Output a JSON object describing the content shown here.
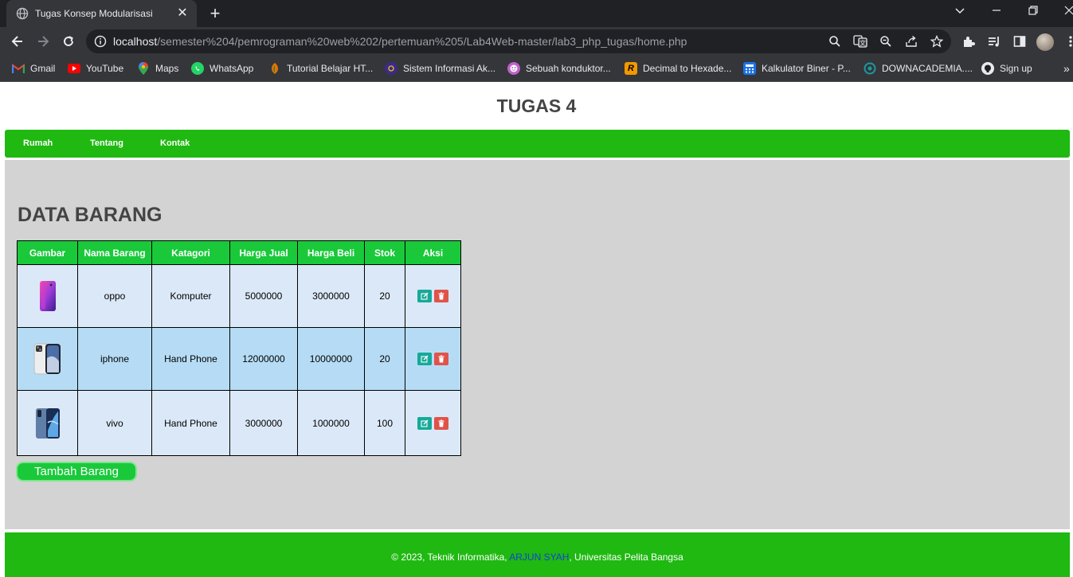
{
  "browser": {
    "tab_title": "Tugas Konsep Modularisasi",
    "url_host": "localhost",
    "url_path": "/semester%204/pemrograman%20web%202/pertemuan%205/Lab4Web-master/lab3_php_tugas/home.php",
    "bookmarks": [
      {
        "label": "Gmail",
        "icon": "gmail-icon",
        "color": "#ea4335"
      },
      {
        "label": "YouTube",
        "icon": "youtube-icon",
        "color": "#ff0000"
      },
      {
        "label": "Maps",
        "icon": "maps-icon",
        "color": "#34a853"
      },
      {
        "label": "WhatsApp",
        "icon": "whatsapp-icon",
        "color": "#25d366"
      },
      {
        "label": "Tutorial Belajar HT...",
        "icon": "tutorial-icon",
        "color": "#e37400"
      },
      {
        "label": "Sistem Informasi Ak...",
        "icon": "sia-icon",
        "color": "#3b2a8c"
      },
      {
        "label": "Sebuah konduktor...",
        "icon": "konduktor-icon",
        "color": "#c061cb"
      },
      {
        "label": "Decimal to Hexade...",
        "icon": "decimal-icon",
        "color": "#f29900"
      },
      {
        "label": "Kalkulator Biner - P...",
        "icon": "calculator-icon",
        "color": "#1a73e8"
      },
      {
        "label": "DOWNACADEMIA....",
        "icon": "downacademia-icon",
        "color": "#1a9aa0"
      },
      {
        "label": "Sign up",
        "icon": "github-icon",
        "color": "#e8eaed"
      }
    ],
    "more_bookmarks": "»"
  },
  "site": {
    "title": "TUGAS 4",
    "nav": [
      "Rumah",
      "Tentang",
      "Kontak"
    ],
    "section_title": "DATA BARANG",
    "table": {
      "headers": [
        "Gambar",
        "Nama Barang",
        "Katagori",
        "Harga Jual",
        "Harga Beli",
        "Stok",
        "Aksi"
      ],
      "rows": [
        {
          "image": "oppo-phone-image",
          "nama": "oppo",
          "katagori": "Komputer",
          "harga_jual": "5000000",
          "harga_beli": "3000000",
          "stok": "20"
        },
        {
          "image": "iphone-phone-image",
          "nama": "iphone",
          "katagori": "Hand Phone",
          "harga_jual": "12000000",
          "harga_beli": "10000000",
          "stok": "20"
        },
        {
          "image": "vivo-phone-image",
          "nama": "vivo",
          "katagori": "Hand Phone",
          "harga_jual": "3000000",
          "harga_beli": "1000000",
          "stok": "100"
        }
      ]
    },
    "add_button": "Tambah Barang",
    "footer": {
      "prefix": "© 2023, Teknik Informatika, ",
      "author": "ARJUN SYAH",
      "suffix": ", Universitas Pelita Bangsa"
    }
  },
  "colors": {
    "nav_green": "#1fb911",
    "header_green": "#19c93a",
    "content_gray": "#d3d3d3",
    "row_light": "#dbe8f7",
    "row_blue": "#b6dcf5",
    "edit_teal": "#16a99a",
    "delete_red": "#e0534a"
  }
}
